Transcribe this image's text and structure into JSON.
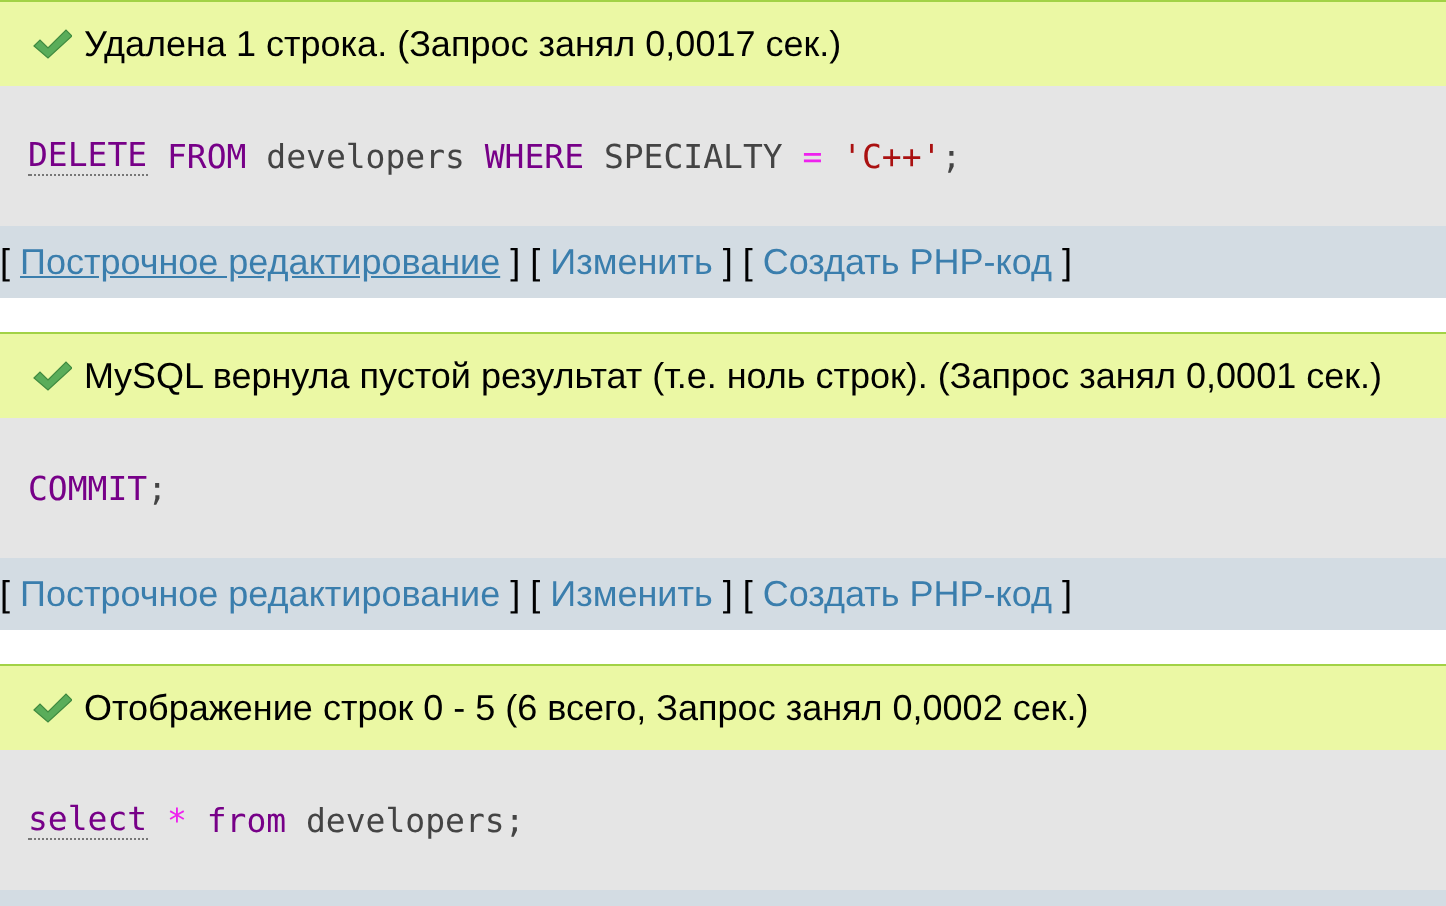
{
  "results": [
    {
      "message": "Удалена 1 строка. (Запрос занял 0,0017 сек.)",
      "sql": [
        {
          "kind": "doc_keyword",
          "text": "DELETE"
        },
        {
          "kind": "keyword",
          "text": "FROM"
        },
        {
          "kind": "plain",
          "text": "developers"
        },
        {
          "kind": "keyword",
          "text": "WHERE"
        },
        {
          "kind": "plain",
          "text": "SPECIALTY"
        },
        {
          "kind": "operator",
          "text": "="
        },
        {
          "kind": "string",
          "text": "'C++'",
          "joined": false
        },
        {
          "kind": "plain",
          "text": ";",
          "joined": true
        }
      ],
      "links": [
        {
          "open": "[",
          "label": "Построчное редактирование",
          "close": "]",
          "hovered": true
        },
        {
          "open": "[",
          "label": "Изменить",
          "close": "]",
          "hovered": false
        },
        {
          "open": "[",
          "label": "Создать PHP-код",
          "close": "]",
          "hovered": false
        }
      ]
    },
    {
      "message": "MySQL вернула пустой результат (т.е. ноль строк). (Запрос занял 0,0001 сек.)",
      "sql": [
        {
          "kind": "keyword",
          "text": "COMMIT"
        },
        {
          "kind": "plain",
          "text": ";",
          "joined": true
        }
      ],
      "links": [
        {
          "open": "[",
          "label": "Построчное редактирование",
          "close": "]",
          "hovered": false
        },
        {
          "open": "[",
          "label": "Изменить",
          "close": "]",
          "hovered": false
        },
        {
          "open": "[",
          "label": "Создать PHP-код",
          "close": "]",
          "hovered": false
        }
      ]
    },
    {
      "message": "Отображение строк 0 - 5 (6 всего, Запрос занял 0,0002 сек.)",
      "sql": [
        {
          "kind": "doc_keyword",
          "text": "select"
        },
        {
          "kind": "operator",
          "text": "*"
        },
        {
          "kind": "keyword",
          "text": "from"
        },
        {
          "kind": "plain",
          "text": "developers"
        },
        {
          "kind": "plain",
          "text": ";",
          "joined": true
        }
      ]
    }
  ]
}
